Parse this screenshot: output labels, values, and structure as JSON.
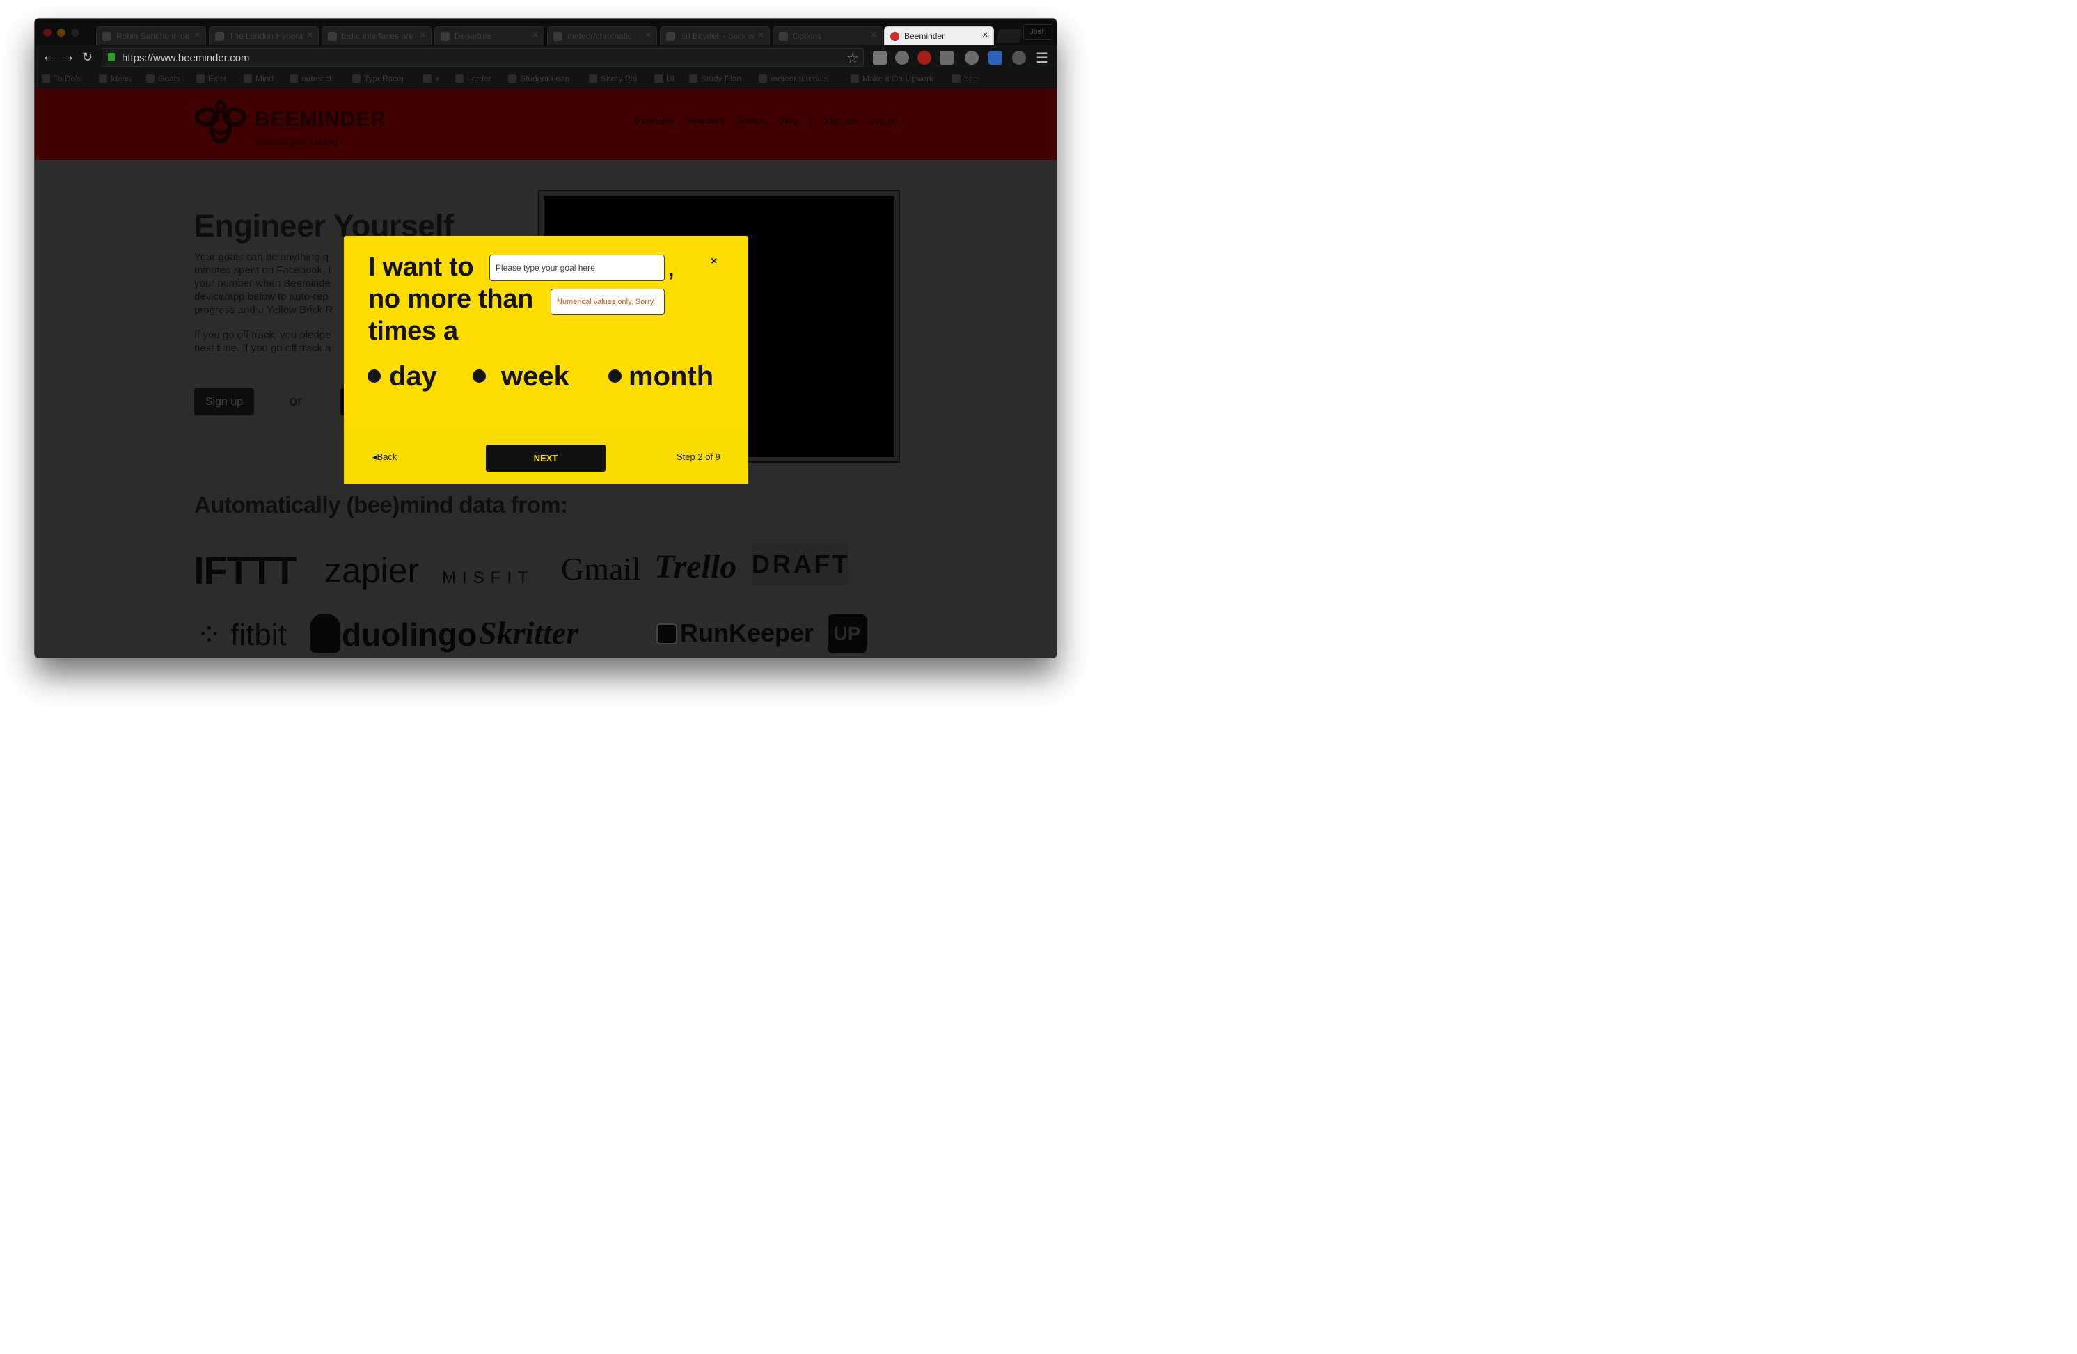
{
  "browser": {
    "tabs": [
      {
        "label": "Robin Sandhu in de"
      },
      {
        "label": "The London Hydera"
      },
      {
        "label": "todo: interfaces are"
      },
      {
        "label": "Departure"
      },
      {
        "label": "meteor/chromatic"
      },
      {
        "label": "Ed Boyden - back w"
      },
      {
        "label": "Options"
      },
      {
        "label": "Beeminder"
      }
    ],
    "profile": "Josh",
    "url": "https://www.beeminder.com",
    "bookmarks": [
      {
        "label": "To Do's"
      },
      {
        "label": "Ideas"
      },
      {
        "label": "Goals"
      },
      {
        "label": "Exist"
      },
      {
        "label": "Mind"
      },
      {
        "label": "outreach"
      },
      {
        "label": "TypeRacer"
      },
      {
        "label": "+"
      },
      {
        "label": "Larder"
      },
      {
        "label": "Student Loan"
      },
      {
        "label": "Shrey Pal"
      },
      {
        "label": "UI"
      },
      {
        "label": "Study Plan"
      },
      {
        "label": "meteor tutorials"
      },
      {
        "label": "Make it On Upwork"
      },
      {
        "label": "bee"
      }
    ]
  },
  "site": {
    "brand": "BEEMINDER",
    "tagline": "Enforced goal tracking",
    "nav": [
      "Overview",
      "Featured",
      "Forum",
      "Blog",
      "|",
      "Sign up",
      "Log in"
    ],
    "headline": "Engineer Yourself",
    "intro_lines": [
      "Your goals can be anything q",
      "minutes spent on Facebook, l",
      "your number when Beeminde",
      "device/app below to auto-rep",
      "progress and a Yellow Brick R"
    ],
    "pledge_lines": [
      "If you go off track, you pledge",
      "next time. If you go off track a"
    ],
    "signup_button": "Sign up",
    "or_text": "or",
    "auto_heading": "Automatically (bee)mind data from:",
    "integrations_row1": [
      "IFTTT",
      "zapier",
      "MISFIT",
      "Gmail",
      "Trello",
      "DRAFT"
    ],
    "integrations_row2": [
      "fitbit",
      "duolingo",
      "Skritter",
      "RunKeeper",
      "UP"
    ]
  },
  "modal": {
    "line1_prefix": "I want to",
    "goal_placeholder": "Please type your goal here",
    "comma": ",",
    "line2_prefix": "no more than",
    "number_placeholder": "Numerical values only. Sorry.",
    "line3": "times a",
    "close_label": "×",
    "options": [
      "day",
      "week",
      "month"
    ],
    "back_label": "Back",
    "next_label": "NEXT",
    "step_text": "Step 2 of 9",
    "accent": "#ffdd00"
  }
}
